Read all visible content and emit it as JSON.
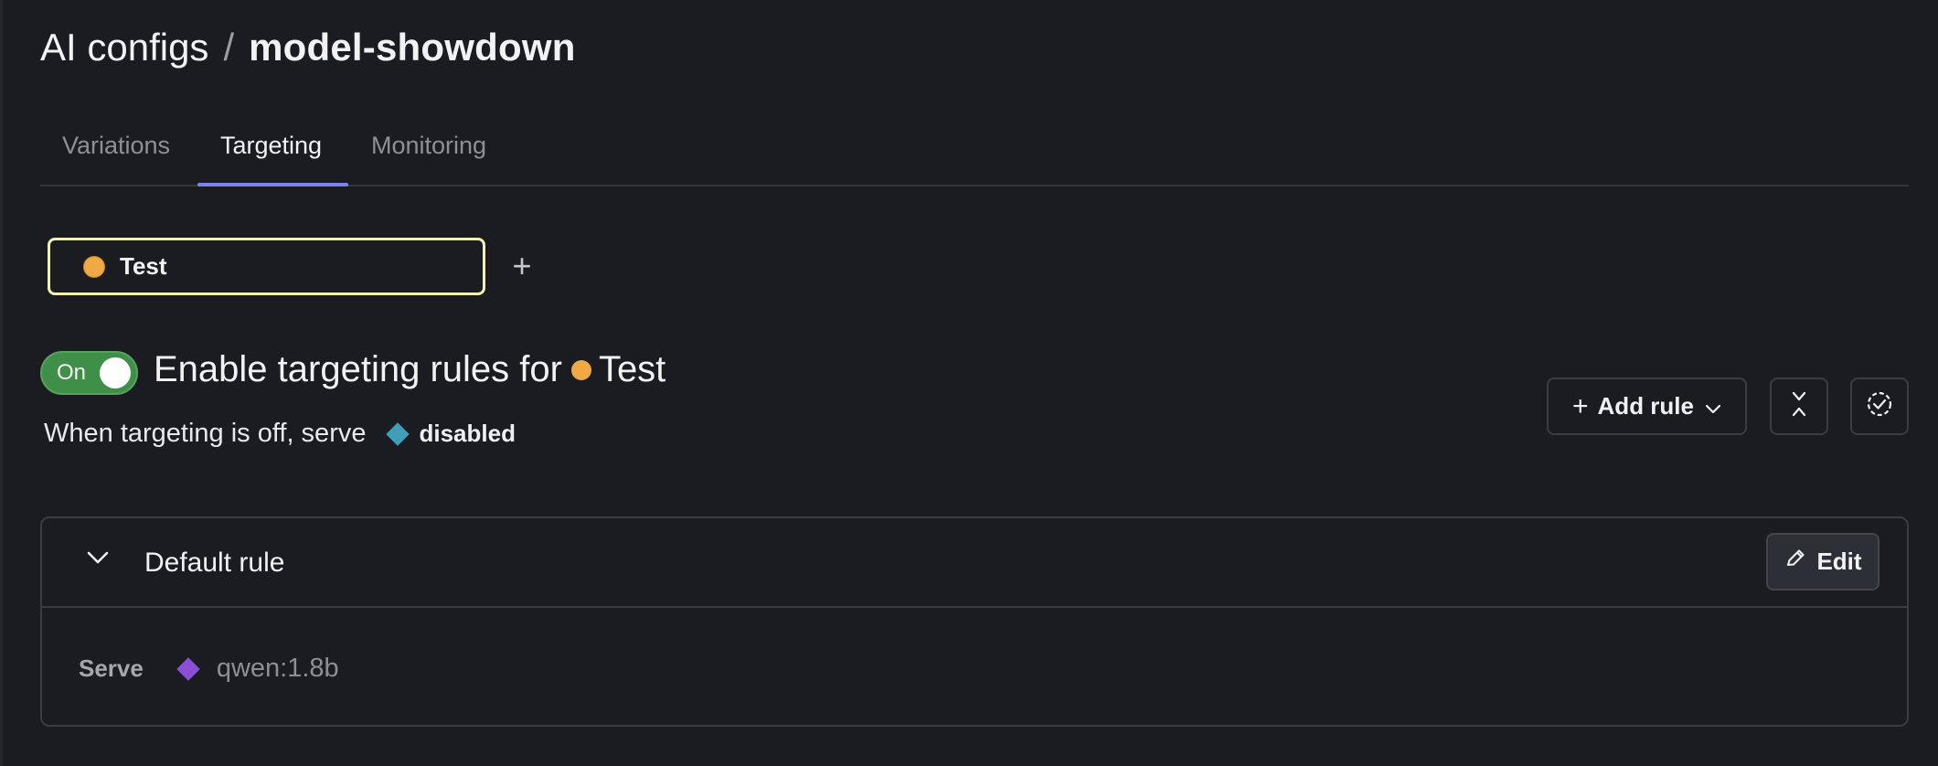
{
  "breadcrumb": {
    "parent": "AI configs",
    "separator": "/",
    "current": "model-showdown"
  },
  "tabs": [
    {
      "label": "Variations",
      "active": false
    },
    {
      "label": "Targeting",
      "active": true
    },
    {
      "label": "Monitoring",
      "active": false
    }
  ],
  "environment": {
    "name": "Test",
    "dot_color": "#efaa46",
    "add_icon": "plus-icon"
  },
  "targeting": {
    "toggle_label": "On",
    "toggle_state": true,
    "title_prefix": "Enable targeting rules for",
    "environment_name": "Test",
    "off_serve_text": "When targeting is off, serve",
    "off_variation": "disabled",
    "off_variation_color": "#3f9fba"
  },
  "toolbar": {
    "add_rule_label": "Add rule",
    "collapse_icon": "collapse-icon",
    "check_icon": "dashed-check-circle-icon"
  },
  "default_rule": {
    "title": "Default rule",
    "edit_label": "Edit",
    "serve_label": "Serve",
    "variation": "qwen:1.8b",
    "variation_color": "#8b4fd6"
  },
  "colors": {
    "background": "#1b1c21",
    "accent": "#7b83eb",
    "toggle_on": "#3f8f48",
    "environment_focus": "#f4f1b4"
  }
}
